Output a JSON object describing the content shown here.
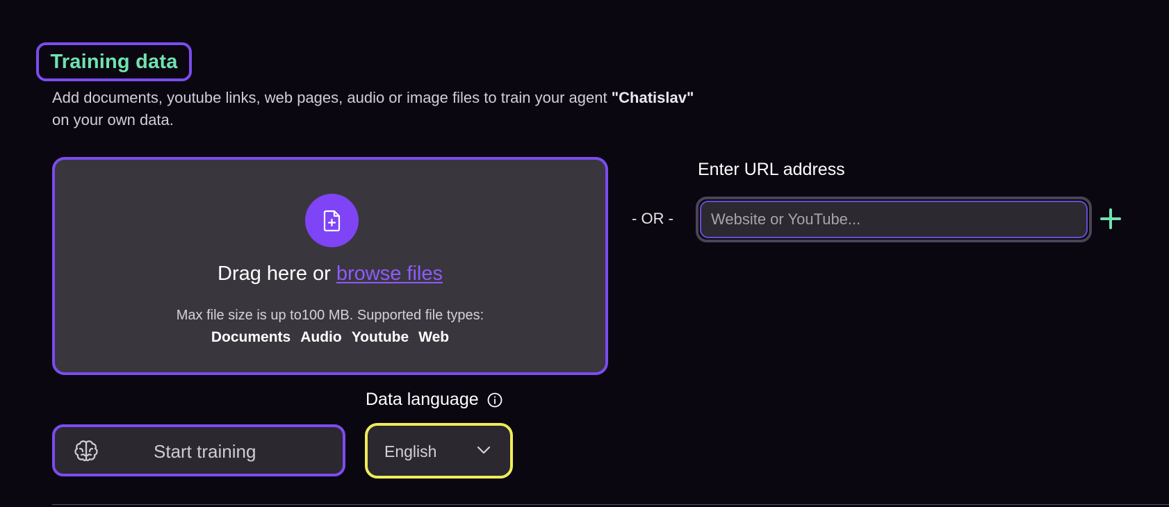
{
  "section": {
    "title": "Training data",
    "description_prefix": "Add documents, youtube links, web pages, audio or image files to train your agent ",
    "agent_name": "\"Chatislav\"",
    "description_suffix": "on your own data."
  },
  "dropzone": {
    "drag_text": "Drag here or ",
    "browse_link": "browse files",
    "size_info": "Max file size is up to100 MB. Supported file types:",
    "file_types": [
      "Documents",
      "Audio",
      "Youtube",
      "Web"
    ],
    "icon": "file-plus-icon"
  },
  "separator": {
    "or_text": "- OR -"
  },
  "url": {
    "label": "Enter URL address",
    "placeholder": "Website or YouTube...",
    "value": "",
    "add_icon": "plus-icon"
  },
  "training": {
    "button_label": "Start training",
    "icon": "brain-icon"
  },
  "language": {
    "label": "Data language",
    "selected": "English",
    "info_icon": "info-icon",
    "chevron_icon": "chevron-down-icon"
  },
  "colors": {
    "background": "#0b0710",
    "accent_purple": "#7b4cf2",
    "accent_green": "#6fe3b0",
    "highlight_yellow": "#f0ec5a",
    "panel": "#3a363d"
  }
}
